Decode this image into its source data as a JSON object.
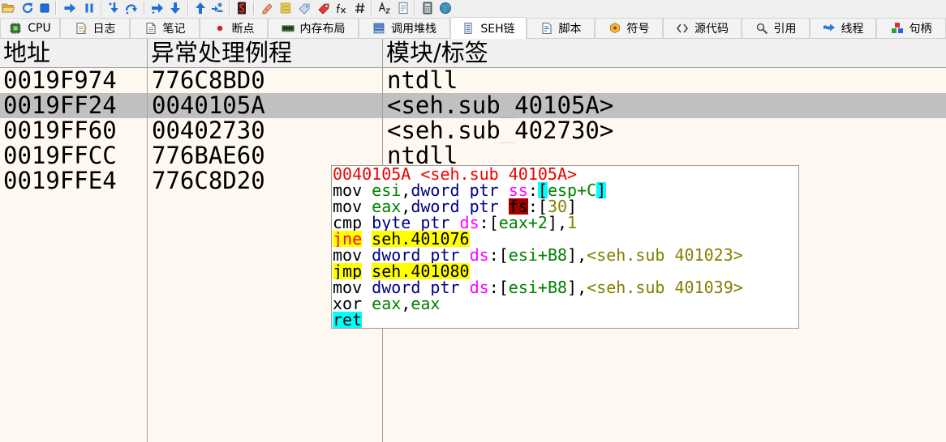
{
  "colors": {
    "background": "#fff8f0",
    "selection": "#c0c0c0"
  },
  "toolbar": {
    "buttons": [
      {
        "icon": "open-folder-icon"
      },
      {
        "icon": "restart-icon"
      },
      {
        "icon": "stop-icon"
      },
      {
        "icon": "run-icon"
      },
      {
        "icon": "pause-icon"
      },
      {
        "icon": "step-into-icon"
      },
      {
        "icon": "step-over-icon"
      },
      {
        "icon": "trace-into-icon"
      },
      {
        "icon": "trace-over-icon"
      },
      {
        "icon": "execute-till-return-icon"
      },
      {
        "icon": "run-to-user-code-icon"
      },
      {
        "icon": "scylla-icon"
      },
      {
        "icon": "patch-icon"
      },
      {
        "icon": "comments-icon"
      },
      {
        "icon": "labels-icon"
      },
      {
        "icon": "bookmarks-icon"
      },
      {
        "icon": "fx-icon"
      },
      {
        "icon": "hash-icon"
      },
      {
        "icon": "az-icon"
      },
      {
        "icon": "notepad-icon"
      },
      {
        "icon": "calculator-icon"
      },
      {
        "icon": "globe-icon"
      }
    ]
  },
  "tabs": [
    {
      "label": "CPU",
      "icon": "cpu-icon",
      "active": false
    },
    {
      "label": "日志",
      "icon": "log-icon",
      "active": false
    },
    {
      "label": "笔记",
      "icon": "notes-icon",
      "active": false
    },
    {
      "label": "断点",
      "icon": "breakpoint-icon",
      "active": false
    },
    {
      "label": "内存布局",
      "icon": "memory-map-icon",
      "active": false
    },
    {
      "label": "调用堆栈",
      "icon": "call-stack-icon",
      "active": false
    },
    {
      "label": "SEH链",
      "icon": "seh-chain-icon",
      "active": true
    },
    {
      "label": "脚本",
      "icon": "script-icon",
      "active": false
    },
    {
      "label": "符号",
      "icon": "symbols-icon",
      "active": false
    },
    {
      "label": "源代码",
      "icon": "source-icon",
      "active": false
    },
    {
      "label": "引用",
      "icon": "references-icon",
      "active": false
    },
    {
      "label": "线程",
      "icon": "threads-icon",
      "active": false
    },
    {
      "label": "句柄",
      "icon": "handles-icon",
      "active": false
    }
  ],
  "table": {
    "headers": {
      "address": "地址",
      "handler": "异常处理例程",
      "label": "模块/标签"
    },
    "rows": [
      {
        "address": "0019F974",
        "handler": "776C8BD0",
        "label": "ntdll",
        "selected": false
      },
      {
        "address": "0019FF24",
        "handler": "0040105A",
        "label": "<seh.sub_40105A>",
        "selected": true
      },
      {
        "address": "0019FF60",
        "handler": "00402730",
        "label": "<seh.sub_402730>",
        "selected": false
      },
      {
        "address": "0019FFCC",
        "handler": "776BAE60",
        "label": "ntdll",
        "selected": false
      },
      {
        "address": "0019FFE4",
        "handler": "776C8D20",
        "selected": false
      }
    ]
  },
  "tooltip": {
    "lines": [
      {
        "tokens": [
          {
            "text": "0040105A <seh.sub_40105A>",
            "color": "#ee0000"
          }
        ]
      },
      {
        "tokens": [
          {
            "text": "mov ",
            "color": "#000000"
          },
          {
            "text": "esi",
            "color": "#008000"
          },
          {
            "text": ",",
            "color": "#000000"
          },
          {
            "text": "dword ptr ",
            "color": "#000080"
          },
          {
            "text": "ss",
            "color": "#ff00ff"
          },
          {
            "text": ":",
            "color": "#000000"
          },
          {
            "text": "[",
            "color": "#000000",
            "bg": "#00ffff"
          },
          {
            "text": "esp+C",
            "color": "#008000"
          },
          {
            "text": "]",
            "color": "#000000",
            "bg": "#00ffff"
          }
        ]
      },
      {
        "tokens": [
          {
            "text": "mov ",
            "color": "#000000"
          },
          {
            "text": "eax",
            "color": "#008000"
          },
          {
            "text": ",",
            "color": "#000000"
          },
          {
            "text": "dword ptr ",
            "color": "#000080"
          },
          {
            "text": "fs",
            "color": "#000000",
            "bg": "#a00000"
          },
          {
            "text": ":",
            "color": "#000000"
          },
          {
            "text": "[",
            "color": "#000000"
          },
          {
            "text": "30",
            "color": "#828200"
          },
          {
            "text": "]",
            "color": "#000000"
          }
        ]
      },
      {
        "tokens": [
          {
            "text": "cmp ",
            "color": "#000000"
          },
          {
            "text": "byte ptr ",
            "color": "#000080"
          },
          {
            "text": "ds",
            "color": "#ff00ff"
          },
          {
            "text": ":",
            "color": "#000000"
          },
          {
            "text": "[",
            "color": "#000000"
          },
          {
            "text": "eax+2",
            "color": "#008000"
          },
          {
            "text": "]",
            "color": "#000000"
          },
          {
            "text": ",",
            "color": "#000000"
          },
          {
            "text": "1",
            "color": "#828200"
          }
        ]
      },
      {
        "tokens": [
          {
            "text": "jne",
            "color": "#ff0000",
            "bg": "#ffff00"
          },
          {
            "text": " ",
            "color": "#000000"
          },
          {
            "text": "seh.401076",
            "color": "#000000",
            "bg": "#ffff00"
          }
        ]
      },
      {
        "tokens": [
          {
            "text": "mov ",
            "color": "#000000"
          },
          {
            "text": "dword ptr ",
            "color": "#000080"
          },
          {
            "text": "ds",
            "color": "#ff00ff"
          },
          {
            "text": ":",
            "color": "#000000"
          },
          {
            "text": "[",
            "color": "#000000"
          },
          {
            "text": "esi+B8",
            "color": "#008000"
          },
          {
            "text": "]",
            "color": "#000000"
          },
          {
            "text": ",",
            "color": "#000000"
          },
          {
            "text": "<seh.sub_401023>",
            "color": "#808000"
          }
        ]
      },
      {
        "tokens": [
          {
            "text": "jmp",
            "color": "#000000",
            "bg": "#ffff00"
          },
          {
            "text": " ",
            "color": "#000000"
          },
          {
            "text": "seh.401080",
            "color": "#000000",
            "bg": "#ffff00"
          }
        ]
      },
      {
        "tokens": [
          {
            "text": "mov ",
            "color": "#000000"
          },
          {
            "text": "dword ptr ",
            "color": "#000080"
          },
          {
            "text": "ds",
            "color": "#ff00ff"
          },
          {
            "text": ":",
            "color": "#000000"
          },
          {
            "text": "[",
            "color": "#000000"
          },
          {
            "text": "esi+B8",
            "color": "#008000"
          },
          {
            "text": "]",
            "color": "#000000"
          },
          {
            "text": ",",
            "color": "#000000"
          },
          {
            "text": "<seh.sub_401039>",
            "color": "#808000"
          }
        ]
      },
      {
        "tokens": [
          {
            "text": "xor ",
            "color": "#000000"
          },
          {
            "text": "eax",
            "color": "#008000"
          },
          {
            "text": ",",
            "color": "#000000"
          },
          {
            "text": "eax",
            "color": "#008000"
          }
        ]
      },
      {
        "tokens": [
          {
            "text": "ret",
            "color": "#000000",
            "bg": "#00ffff"
          }
        ]
      }
    ]
  }
}
